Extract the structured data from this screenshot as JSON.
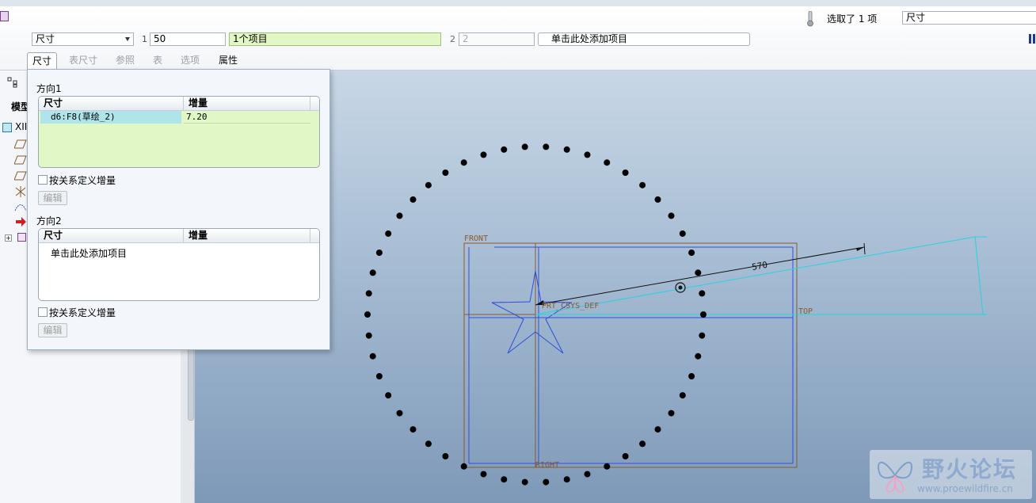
{
  "toolbar": {
    "dim_type_value": "尺寸",
    "dir1_label": "1",
    "dir1_count": "50",
    "dir1_items": "1个项目",
    "dir2_label": "2",
    "dir2_count": "2",
    "dir2_add": "单击此处添加项目",
    "selected_text": "选取了 1 项",
    "filter_value": "尺寸"
  },
  "tabs": [
    "尺寸",
    "表尺寸",
    "参照",
    "表",
    "选项",
    "属性"
  ],
  "tree": {
    "header": "模型",
    "root": "XII"
  },
  "panel": {
    "dir1_title": "方向1",
    "dir2_title": "方向2",
    "col_dim": "尺寸",
    "col_inc": "增量",
    "row1_dim": "d6:F8(草绘_2)",
    "row1_inc": "7.20",
    "add_item": "单击此处添加项目",
    "relation_check": "按关系定义增量",
    "edit_button": "编辑"
  },
  "sketch": {
    "label_front": "FRONT",
    "label_top": "TOP",
    "label_right": "RIGHT",
    "label_csys": "PRT_CSYS_DEF",
    "dimension": "570",
    "pattern_count": 50
  },
  "watermark": {
    "title": "野火论坛",
    "url": "www.proewildfire.cn"
  },
  "colors": {
    "datum": "#8a5a2b",
    "cyan": "#25d3e0",
    "blue": "#2f4fd8",
    "panel_green": "#e2f7c6",
    "selected_row": "#aee4ea"
  }
}
